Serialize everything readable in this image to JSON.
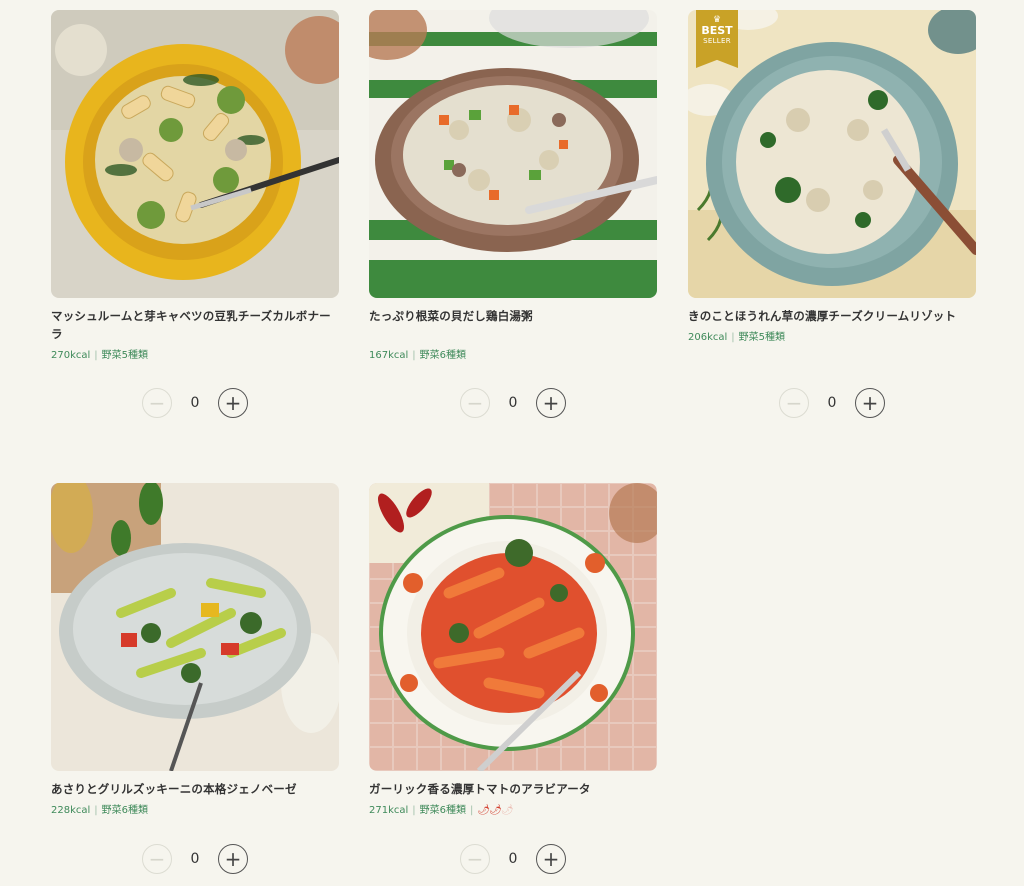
{
  "products": [
    {
      "title": "マッシュルームと芽キャベツの豆乳チーズカルボナーラ",
      "kcal": "270kcal",
      "veg": "野菜5種類",
      "qty": "0",
      "separator": "|"
    },
    {
      "title": "たっぷり根菜の貝だし鶏白湯粥",
      "kcal": "167kcal",
      "veg": "野菜6種類",
      "qty": "0",
      "separator": "|"
    },
    {
      "title": "きのことほうれん草の濃厚チーズクリームリゾット",
      "kcal": "206kcal",
      "veg": "野菜5種類",
      "qty": "0",
      "separator": "|",
      "badge": {
        "line1": "BEST",
        "line2": "SELLER",
        "icon": "crown-icon"
      }
    },
    {
      "title": "あさりとグリルズッキーニの本格ジェノベーゼ",
      "kcal": "228kcal",
      "veg": "野菜6種類",
      "qty": "0",
      "separator": "|"
    },
    {
      "title": "ガーリック香る濃厚トマトのアラビアータ",
      "kcal": "271kcal",
      "veg": "野菜6種類",
      "qty": "0",
      "separator": "|",
      "spice_icon": "chili-pepper-icon",
      "spice_level": "2 of 3"
    }
  ],
  "controls": {
    "minus": "−",
    "plus": "+"
  },
  "colors": {
    "accent": "#3f8a5a",
    "badge": "#c9a227",
    "background": "#f6f5ee"
  }
}
